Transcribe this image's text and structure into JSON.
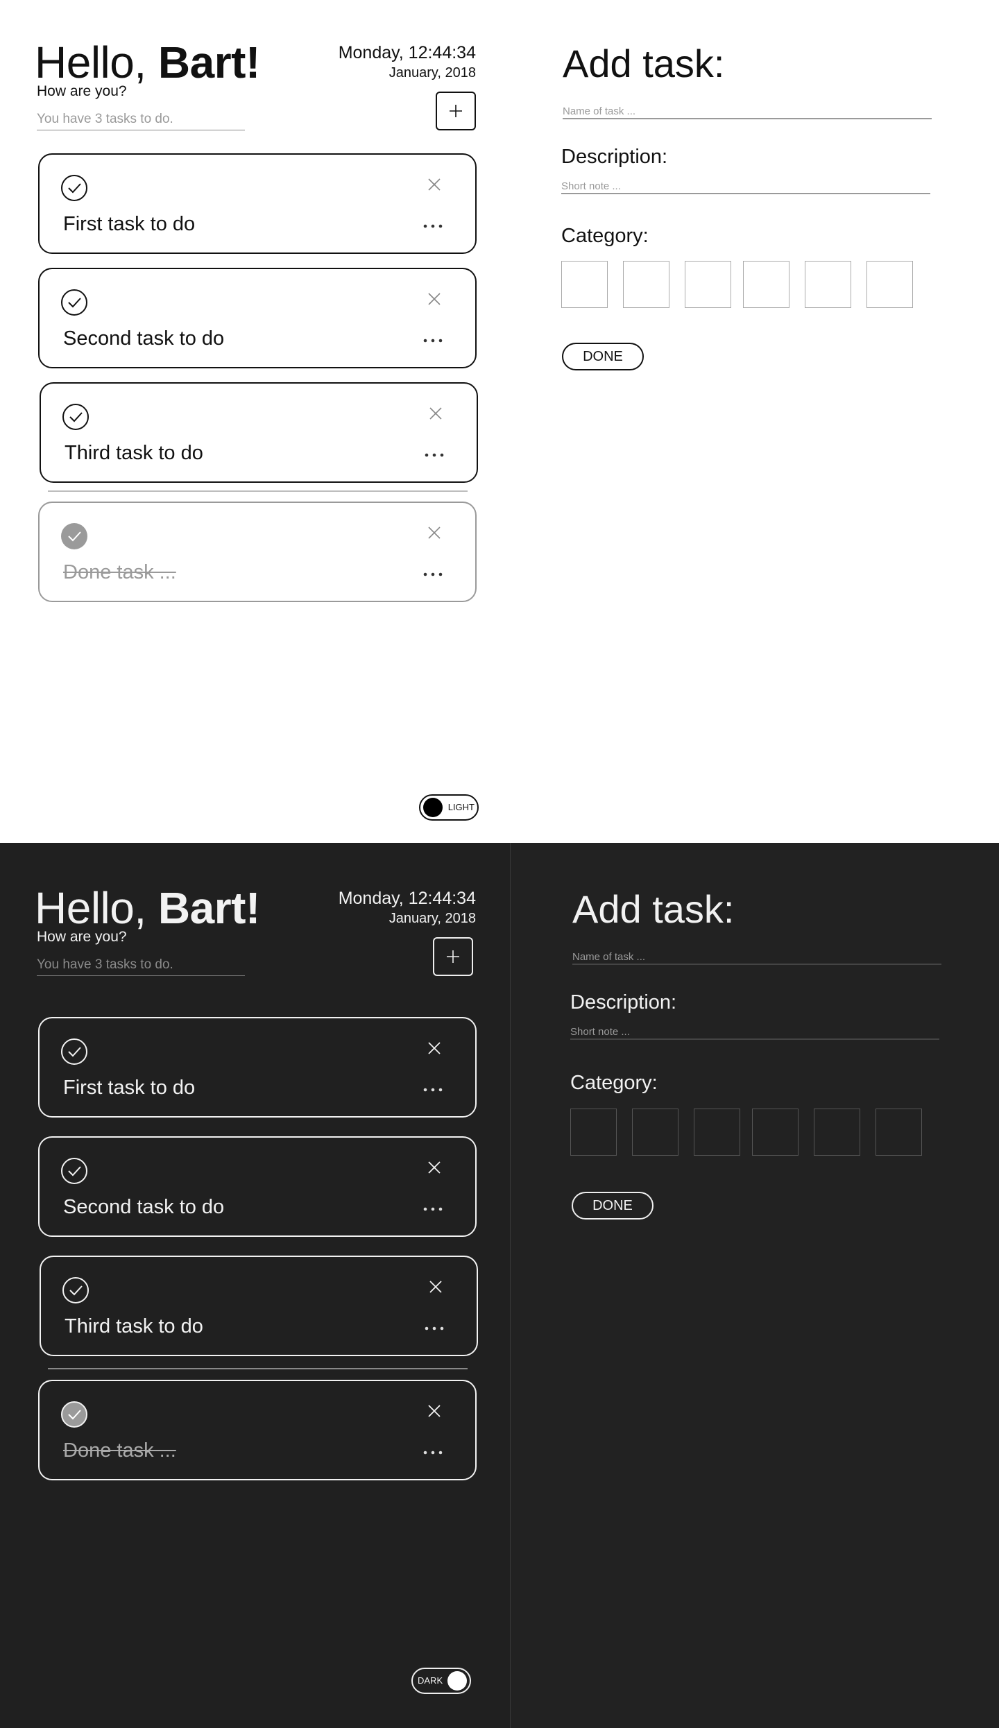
{
  "header": {
    "greeting_prefix": "Hello, ",
    "greeting_name": "Bart!",
    "subtitle": "How are you?",
    "tasks_count": "You have 3 tasks to do.",
    "date_line1": "Monday, 12:44:34",
    "date_line2": "January, 2018",
    "add_button_label": "+"
  },
  "tasks": [
    {
      "label": "First task to do",
      "done": false
    },
    {
      "label": "Second task to do",
      "done": false
    },
    {
      "label": "Third task to do",
      "done": false
    },
    {
      "label": "Done task ...",
      "done": true
    }
  ],
  "form": {
    "title": "Add task:",
    "name_placeholder": "Name of task ...",
    "description_label": "Description:",
    "description_placeholder": "Short note ...",
    "category_label": "Category:",
    "category_count": 6,
    "done_button": "DONE"
  },
  "themes": {
    "light_label": "LIGHT",
    "dark_label": "DARK"
  },
  "colors": {
    "light_bg": "#ffffff",
    "dark_bg": "#202020",
    "done_check_fill": "#9a9a9a"
  },
  "icons": [
    "check-circle-icon",
    "close-icon",
    "more-dots-icon",
    "plus-icon"
  ]
}
